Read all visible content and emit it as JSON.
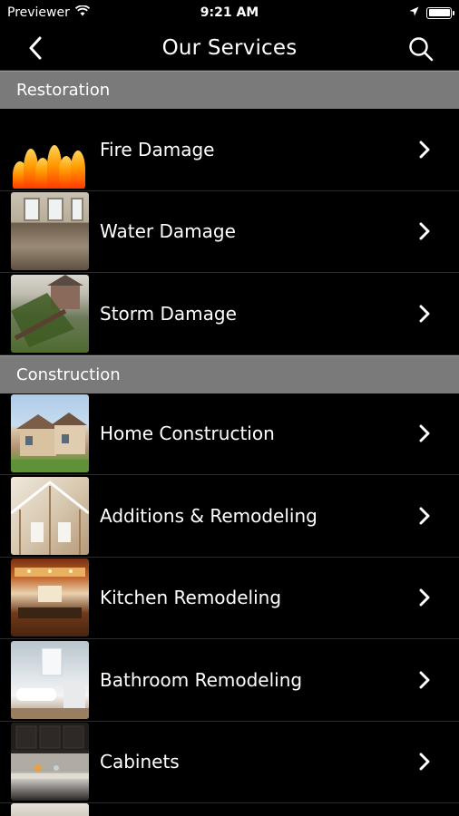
{
  "status_bar": {
    "carrier": "Previewer",
    "time": "9:21 AM"
  },
  "nav": {
    "title": "Our Services"
  },
  "sections": [
    {
      "title": "Restoration",
      "items": [
        {
          "label": "Fire Damage",
          "thumb": "fire"
        },
        {
          "label": "Water Damage",
          "thumb": "water"
        },
        {
          "label": "Storm Damage",
          "thumb": "storm"
        }
      ]
    },
    {
      "title": "Construction",
      "items": [
        {
          "label": "Home Construction",
          "thumb": "home"
        },
        {
          "label": "Additions & Remodeling",
          "thumb": "addition"
        },
        {
          "label": "Kitchen Remodeling",
          "thumb": "kitchen"
        },
        {
          "label": "Bathroom Remodeling",
          "thumb": "bath"
        },
        {
          "label": "Cabinets",
          "thumb": "cabinets"
        }
      ]
    }
  ],
  "icons": {
    "back": "chevron-left-icon",
    "search": "search-icon",
    "row_chevron": "chevron-right-icon",
    "wifi": "wifi-icon",
    "location": "location-arrow-icon",
    "battery": "battery-icon"
  },
  "colors": {
    "background": "#000000",
    "section_header": "#7a7a7a",
    "text": "#ffffff"
  }
}
